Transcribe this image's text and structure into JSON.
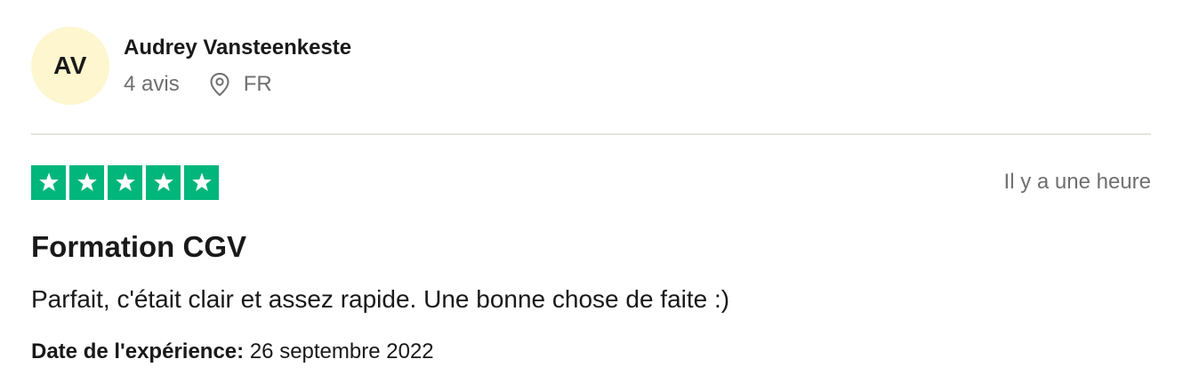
{
  "consumer": {
    "initials": "AV",
    "name": "Audrey Vansteenkeste",
    "review_count": "4 avis",
    "country": "FR",
    "location_icon": "location-pin-icon",
    "avatar_color": "#fdf6cf"
  },
  "review": {
    "rating": 5,
    "rating_max": 5,
    "star_color": "#00b67a",
    "star_icon": "star-icon",
    "time_ago": "Il y a une heure",
    "title": "Formation CGV",
    "text": "Parfait, c'était clair et assez rapide. Une bonne chose de faite :)",
    "experience_label": "Date de l'expérience:",
    "experience_date": "26 septembre 2022"
  }
}
